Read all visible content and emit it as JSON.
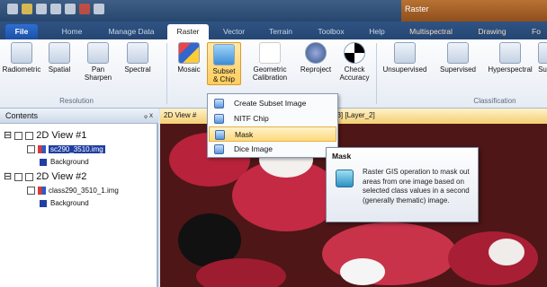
{
  "titlebar": {
    "context_group": "Raster"
  },
  "tabs": [
    {
      "label": "File"
    },
    {
      "label": "Home"
    },
    {
      "label": "Manage Data"
    },
    {
      "label": "Raster"
    },
    {
      "label": "Vector"
    },
    {
      "label": "Terrain"
    },
    {
      "label": "Toolbox"
    },
    {
      "label": "Help"
    },
    {
      "label": "Multispectral"
    },
    {
      "label": "Drawing"
    },
    {
      "label": "Fo"
    }
  ],
  "ribbon": {
    "resolution": {
      "label": "Resolution",
      "buttons": [
        "Radiometric",
        "Spatial",
        "Pan\nSharpen",
        "Spectral"
      ]
    },
    "main_buttons": [
      "Mosaic",
      "Subset\n& Chip",
      "Geometric\nCalibration",
      "Reproject",
      "Check\nAccuracy"
    ],
    "classification": {
      "label": "Classification",
      "buttons": [
        "Unsupervised",
        "Supervised",
        "Hyperspectral",
        "Su"
      ]
    }
  },
  "contents": {
    "title": "Contents",
    "pin": "ᵩ x",
    "views": [
      {
        "name": "2D View #1",
        "layer": "sc290_3510.img",
        "background": "Background"
      },
      {
        "name": "2D View #2",
        "layer": "class290_3510_1.img",
        "background": "Background"
      }
    ]
  },
  "viewtabs": {
    "tab1": "2D View #",
    "tab2": "_3] [Layer_2]"
  },
  "menu": {
    "items": [
      "Create Subset Image",
      "NITF Chip",
      "Mask",
      "Dice Image"
    ]
  },
  "tooltip": {
    "title": "Mask",
    "body": "Raster GIS operation to mask out areas from one image based on selected class values in a second (generally thematic) image."
  }
}
